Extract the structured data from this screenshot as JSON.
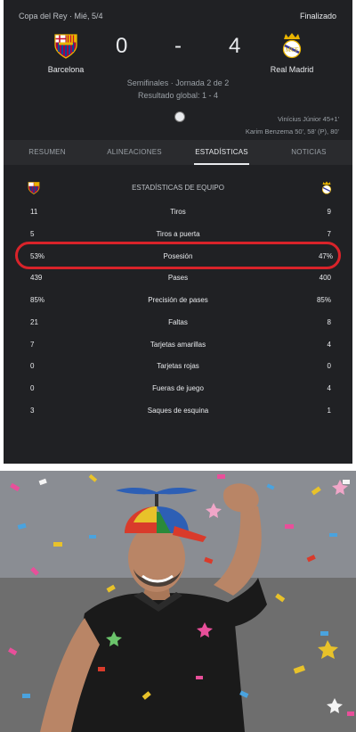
{
  "match": {
    "competition": "Copa del Rey · Mié, 5/4",
    "status": "Finalizado",
    "home_team": "Barcelona",
    "away_team": "Real Madrid",
    "home_score": "0",
    "separator": "-",
    "away_score": "4",
    "round": "Semifinales · Jornada 2 de 2",
    "aggregate": "Resultado global: 1 - 4",
    "scorers": [
      "Vinícius Júnior 45+1'",
      "Karim Benzema 50', 58' (P), 80'"
    ]
  },
  "tabs": [
    {
      "label": "RESUMEN"
    },
    {
      "label": "ALINEACIONES"
    },
    {
      "label": "ESTADÍSTICAS"
    },
    {
      "label": "NOTICIAS"
    }
  ],
  "stats": {
    "title": "ESTADÍSTICAS DE EQUIPO",
    "rows": [
      {
        "label": "Tiros",
        "home": "11",
        "away": "9"
      },
      {
        "label": "Tiros a puerta",
        "home": "5",
        "away": "7"
      },
      {
        "label": "Posesión",
        "home": "53%",
        "away": "47%"
      },
      {
        "label": "Pases",
        "home": "439",
        "away": "400"
      },
      {
        "label": "Precisión de pases",
        "home": "85%",
        "away": "85%"
      },
      {
        "label": "Faltas",
        "home": "21",
        "away": "8"
      },
      {
        "label": "Tarjetas amarillas",
        "home": "7",
        "away": "4"
      },
      {
        "label": "Tarjetas rojas",
        "home": "0",
        "away": "0"
      },
      {
        "label": "Fueras de juego",
        "home": "0",
        "away": "4"
      },
      {
        "label": "Saques de esquina",
        "home": "3",
        "away": "1"
      }
    ]
  },
  "colors": {
    "highlight_ring": "#d9232a",
    "card_bg": "#202124"
  }
}
